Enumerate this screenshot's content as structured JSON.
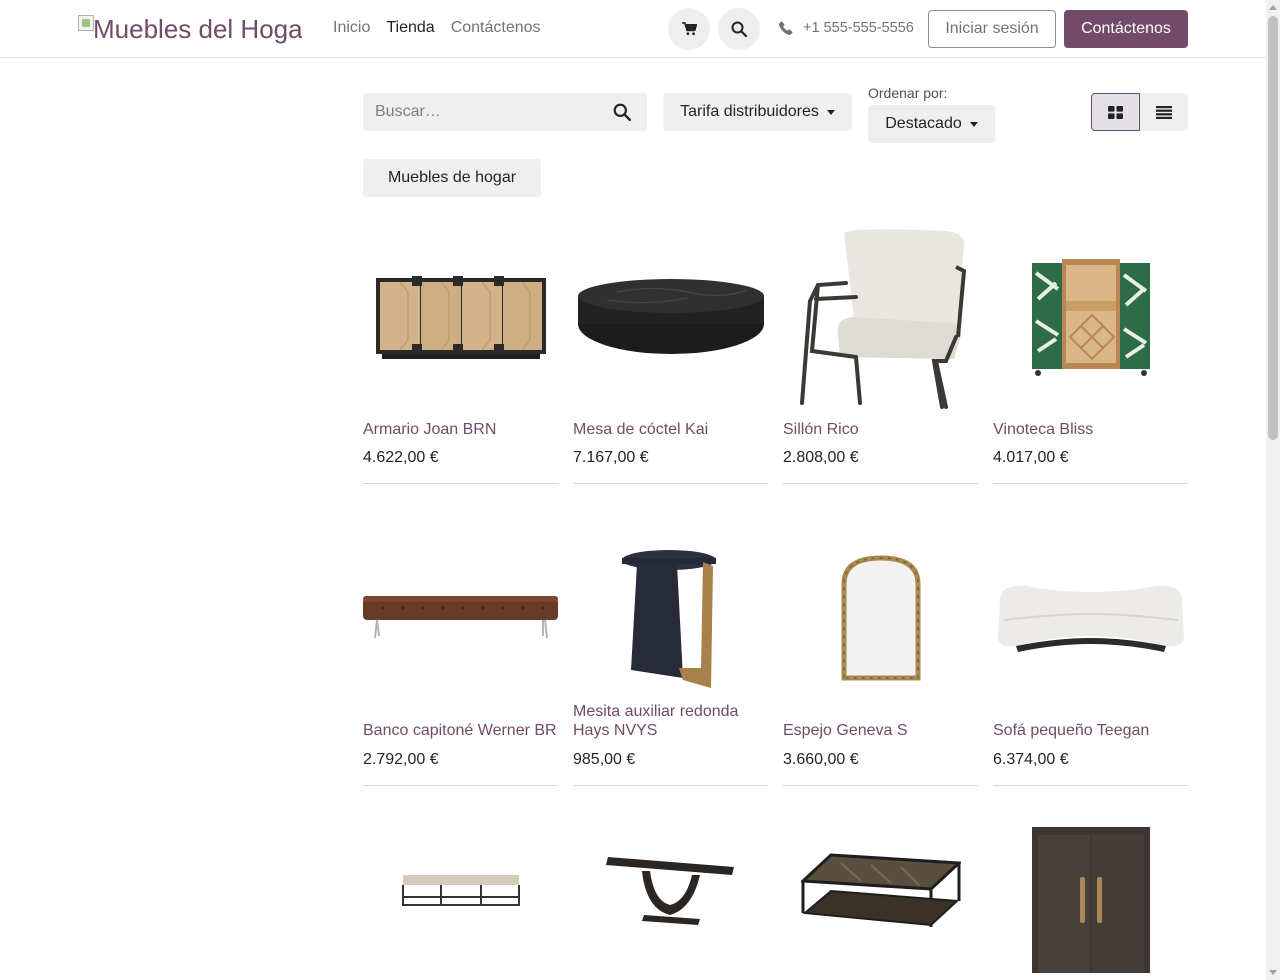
{
  "header": {
    "logo_alt": "Muebles del Hogar",
    "nav": [
      {
        "label": "Inicio",
        "active": false
      },
      {
        "label": "Tienda",
        "active": true
      },
      {
        "label": "Contáctenos",
        "active": false
      }
    ],
    "cart_icon": "cart-icon",
    "search_icon": "search-icon",
    "phone_icon": "phone-icon",
    "phone": "+1 555-555-5556",
    "login_label": "Iniciar sesión",
    "contact_label": "Contáctenos",
    "accent_color": "#714b67"
  },
  "toolbar": {
    "search_placeholder": "Buscar…",
    "pricelist_label": "Tarifa distribuidores",
    "sort_label": "Ordenar por:",
    "sort_value": "Destacado",
    "view_mode": "grid",
    "view_icons": [
      "grid-view-icon",
      "list-view-icon"
    ]
  },
  "category_chip": "Muebles de hogar",
  "products": [
    {
      "name": "Armario Joan BRN",
      "price": "4.622,00 €",
      "image": "sideboard"
    },
    {
      "name": "Mesa de cóctel Kai",
      "price": "7.167,00 €",
      "image": "round-coffee-table"
    },
    {
      "name": "Sillón Rico",
      "price": "2.808,00 €",
      "image": "armchair"
    },
    {
      "name": "Vinoteca Bliss",
      "price": "4.017,00 €",
      "image": "wine-cabinet"
    },
    {
      "name": "Banco capitoné Werner BR",
      "price": "2.792,00 €",
      "image": "tufted-bench"
    },
    {
      "name": "Mesita auxiliar redonda Hays NVYS",
      "price": "985,00 €",
      "image": "side-table"
    },
    {
      "name": "Espejo Geneva S",
      "price": "3.660,00 €",
      "image": "mirror"
    },
    {
      "name": "Sofá pequeño Teegan",
      "price": "6.374,00 €",
      "image": "sofa"
    },
    {
      "name": "",
      "price": "",
      "image": "low-bench"
    },
    {
      "name": "",
      "price": "",
      "image": "console-table"
    },
    {
      "name": "",
      "price": "",
      "image": "square-coffee-table"
    },
    {
      "name": "",
      "price": "",
      "image": "tall-cabinet"
    }
  ]
}
